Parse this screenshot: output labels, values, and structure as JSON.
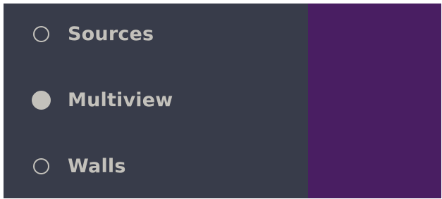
{
  "menu": {
    "items": [
      {
        "label": "Sources",
        "checked": false
      },
      {
        "label": "Multiview",
        "checked": true
      },
      {
        "label": "Walls",
        "checked": false
      }
    ]
  },
  "colors": {
    "menu_background": "#383c4a",
    "accent_panel": "#491e62",
    "radio_and_text": "#c3c1bb"
  }
}
